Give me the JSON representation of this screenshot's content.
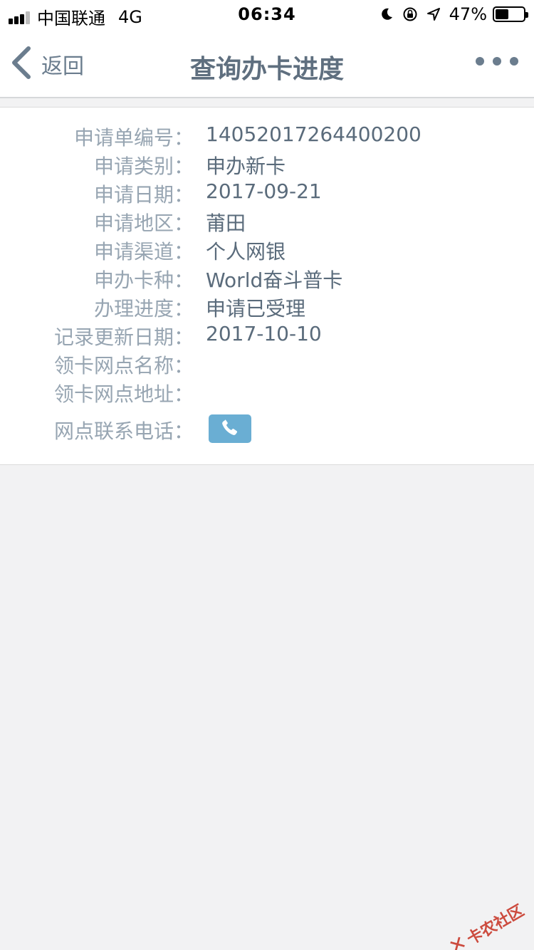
{
  "status_bar": {
    "carrier": "中国联通",
    "network": "4G",
    "time": "06:34",
    "battery": "47%",
    "battery_level": 0.47
  },
  "nav": {
    "back_label": "返回",
    "title": "查询办卡进度"
  },
  "fields": [
    {
      "label": "申请单编号：",
      "value": "14052017264400200"
    },
    {
      "label": "申请类别：",
      "value": "申办新卡"
    },
    {
      "label": "申请日期：",
      "value": "2017-09-21"
    },
    {
      "label": "申请地区：",
      "value": "莆田"
    },
    {
      "label": "申请渠道：",
      "value": "个人网银"
    },
    {
      "label": "申办卡种：",
      "value": "World奋斗普卡"
    },
    {
      "label": "办理进度：",
      "value": "申请已受理"
    },
    {
      "label": "记录更新日期：",
      "value": "2017-10-10"
    },
    {
      "label": "领卡网点名称：",
      "value": ""
    },
    {
      "label": "领卡网点地址：",
      "value": ""
    }
  ],
  "phone": {
    "label": "网点联系电话："
  },
  "watermark": {
    "text": "卡农社区"
  },
  "colors": {
    "accent": "#6aaed3",
    "label": "#97a5b2",
    "value": "#5a6b7b"
  }
}
